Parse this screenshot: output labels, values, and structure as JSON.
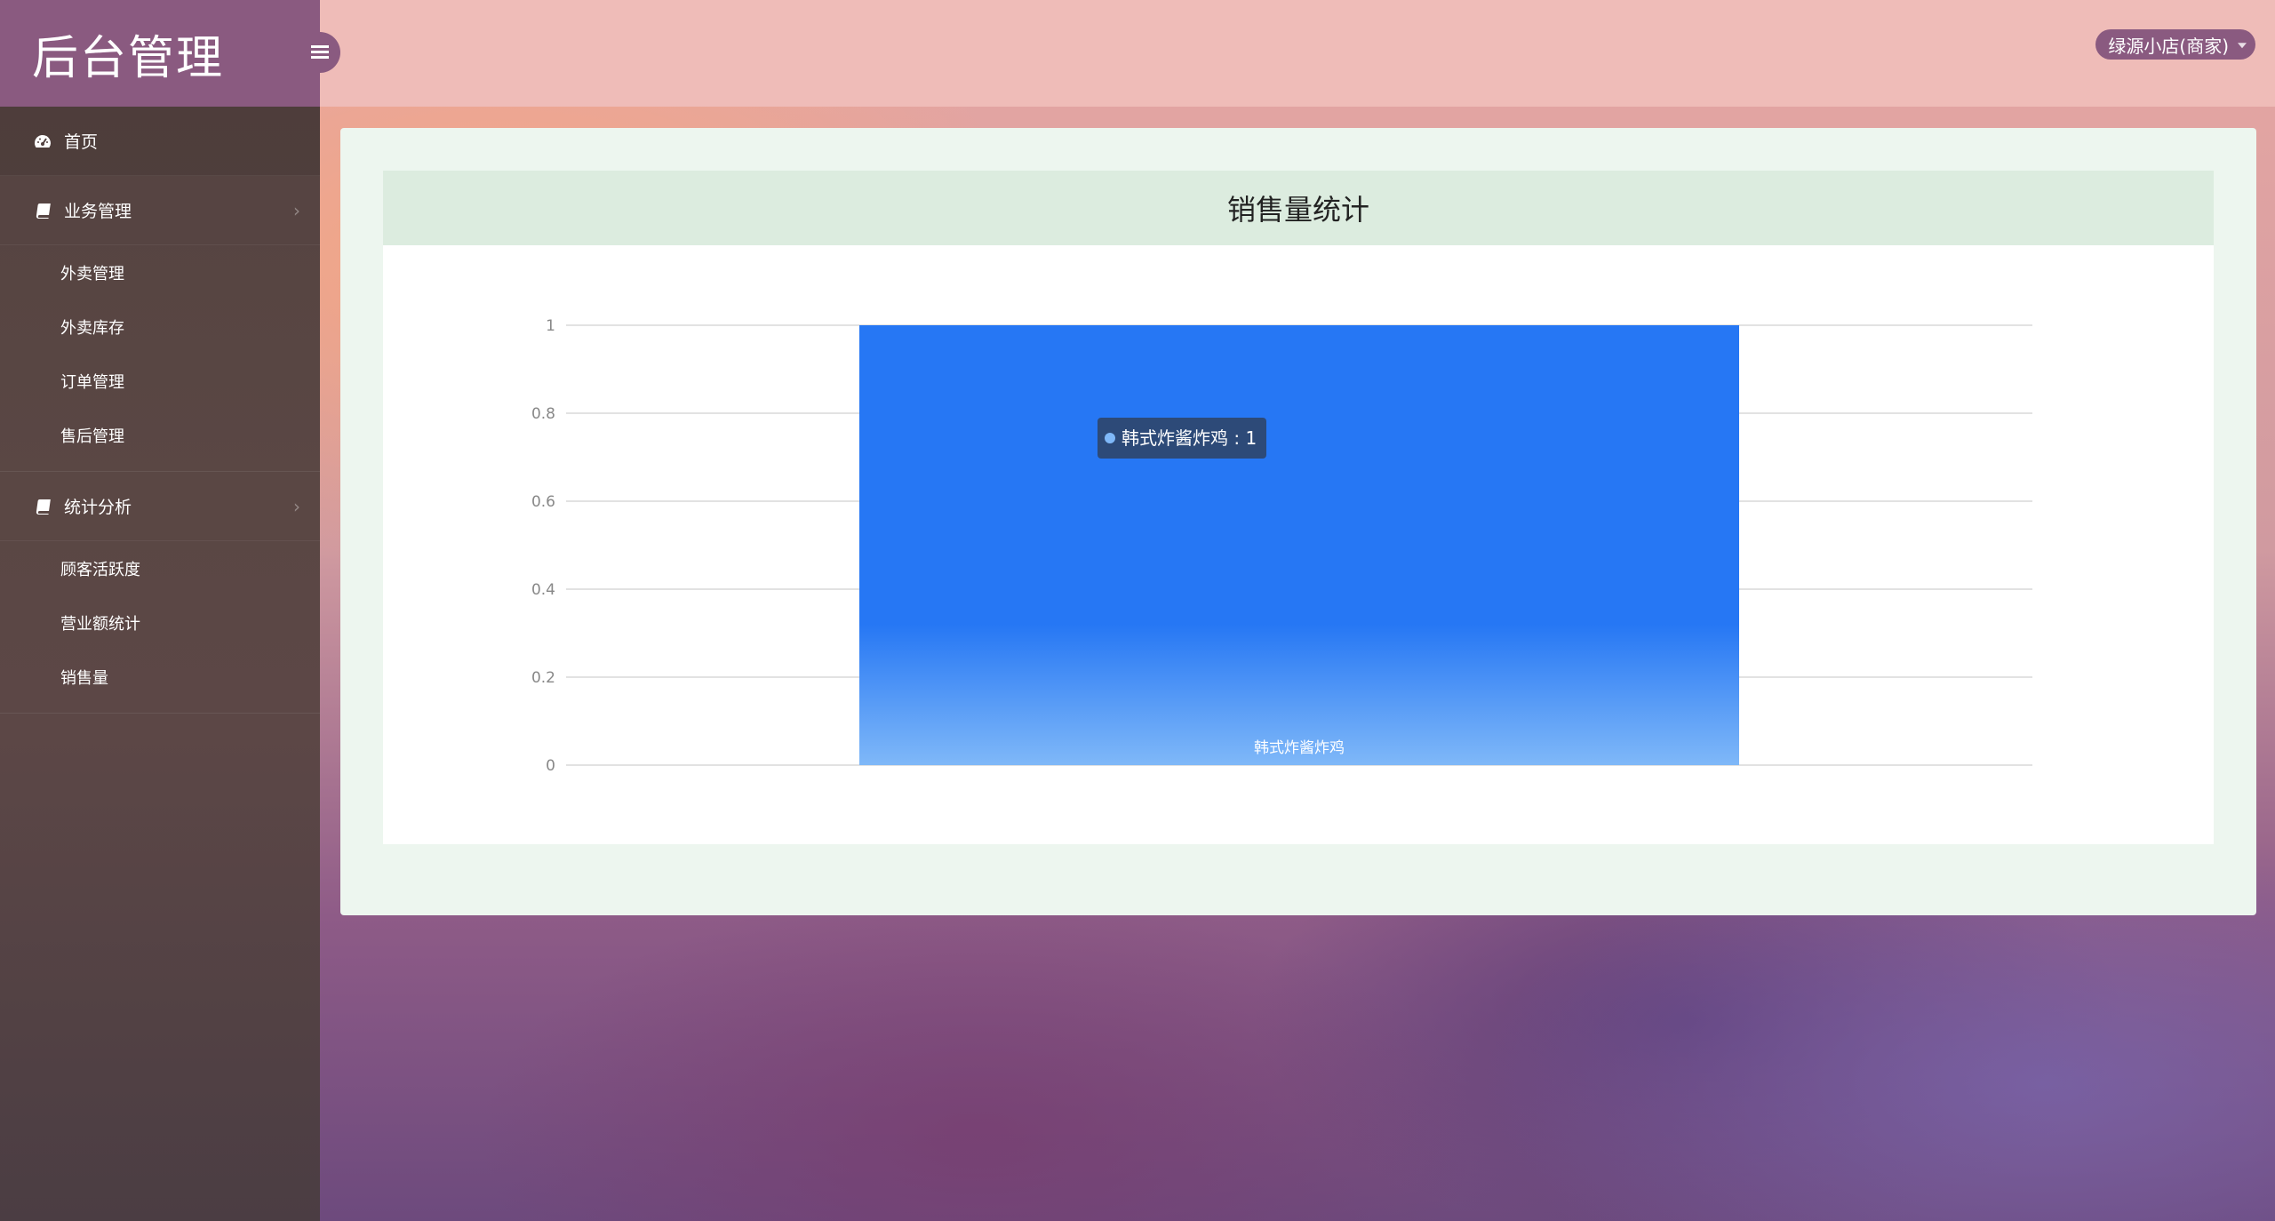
{
  "brand": {
    "title": "后台管理"
  },
  "topbar": {
    "user_label": "绿源小店(商家)"
  },
  "sidebar": {
    "home": {
      "label": "首页",
      "icon": "dashboard-icon"
    },
    "groups": [
      {
        "label": "业务管理",
        "icon": "book-icon",
        "items": [
          "外卖管理",
          "外卖库存",
          "订单管理",
          "售后管理"
        ]
      },
      {
        "label": "统计分析",
        "icon": "book-icon",
        "items": [
          "顾客活跃度",
          "营业额统计",
          "销售量"
        ]
      }
    ]
  },
  "card": {
    "title": "销售量统计"
  },
  "chart_data": {
    "type": "bar",
    "categories": [
      "韩式炸酱炸鸡"
    ],
    "values": [
      1
    ],
    "ylim": [
      0,
      1
    ],
    "yticks": [
      0,
      0.2,
      0.4,
      0.6,
      0.8,
      1
    ],
    "grid": true,
    "tooltip": {
      "text": "韩式炸酱炸鸡 : 1"
    },
    "colors": {
      "bar_top": "#2677f4",
      "bar_bottom": "#7fb8f8",
      "grid": "#d9d9d9",
      "tooltip_bg": "#2d4a78"
    }
  },
  "colors": {
    "sidebar_brand": "#8a5a80",
    "topbar": "#efbcb8",
    "panel": "#edf6ef",
    "card_header": "#dcecdf"
  }
}
